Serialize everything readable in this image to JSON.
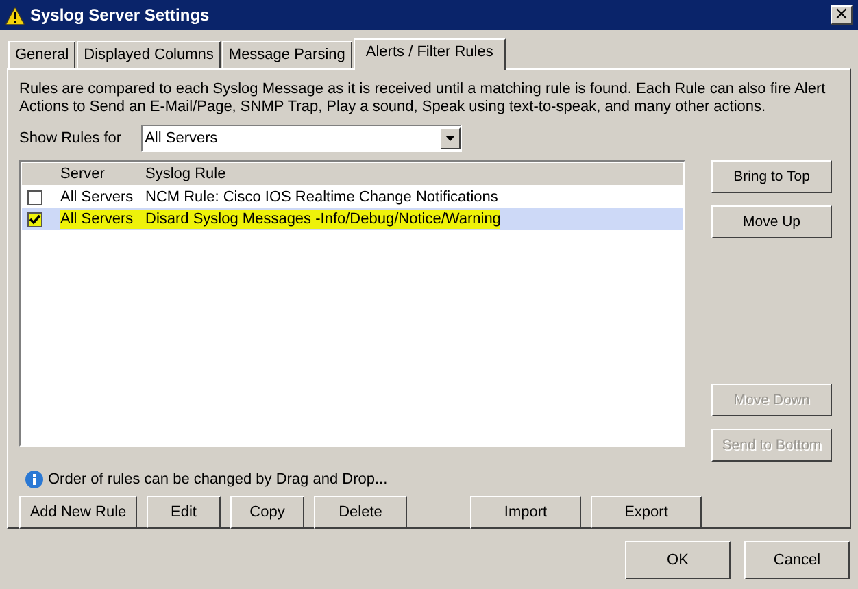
{
  "window": {
    "title": "Syslog Server Settings",
    "close": "×"
  },
  "tabs": [
    {
      "label": "General",
      "selected": false
    },
    {
      "label": "Displayed Columns",
      "selected": false
    },
    {
      "label": "Message Parsing",
      "selected": false
    },
    {
      "label": "Alerts / Filter Rules",
      "selected": true
    }
  ],
  "description": "Rules are compared to each Syslog Message as it is received until a matching rule is found. Each Rule can also fire Alert Actions to Send an E-Mail/Page, SNMP Trap, Play a sound, Speak using text-to-speak, and many other actions.",
  "show_rules_for": {
    "label": "Show Rules for",
    "value": "All Servers"
  },
  "rules_table": {
    "columns": [
      "Server",
      "Syslog Rule"
    ],
    "rows": [
      {
        "checked": false,
        "selected": false,
        "highlighted": false,
        "server": "All Servers",
        "rule": "NCM Rule: Cisco IOS Realtime Change Notifications"
      },
      {
        "checked": true,
        "selected": true,
        "highlighted": true,
        "server": "All Servers",
        "rule": "Disard Syslog Messages -Info/Debug/Notice/Warning"
      }
    ]
  },
  "side_buttons": [
    {
      "label": "Bring to Top",
      "disabled": false
    },
    {
      "label": "Move Up",
      "disabled": false
    },
    {
      "label": "Move Down",
      "disabled": true
    },
    {
      "label": "Send to Bottom",
      "disabled": true
    }
  ],
  "info_note": "Order of rules can be changed by Drag and Drop...",
  "rule_buttons": [
    "Add New Rule",
    "Edit",
    "Copy",
    "Delete"
  ],
  "transfer_buttons": [
    "Import",
    "Export"
  ],
  "dialog_buttons": [
    "OK",
    "Cancel"
  ]
}
